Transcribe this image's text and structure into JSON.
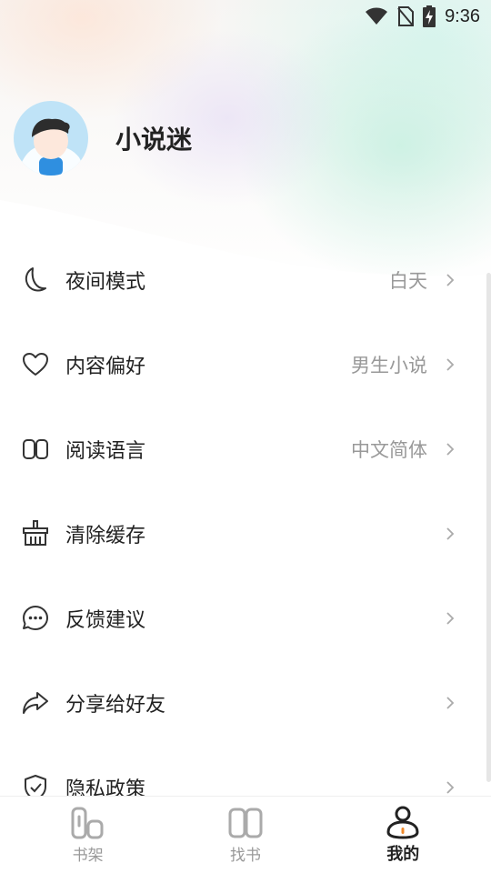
{
  "status_bar": {
    "time": "9:36",
    "icons": [
      "wifi-icon",
      "no-sim-icon",
      "battery-charging-icon"
    ]
  },
  "profile": {
    "username": "小说迷"
  },
  "menu": {
    "items": [
      {
        "label": "夜间模式",
        "value": "白天",
        "icon": "moon-icon"
      },
      {
        "label": "内容偏好",
        "value": "男生小说",
        "icon": "heart-icon"
      },
      {
        "label": "阅读语言",
        "value": "中文简体",
        "icon": "book-open-icon"
      },
      {
        "label": "清除缓存",
        "value": "",
        "icon": "broom-icon"
      },
      {
        "label": "反馈建议",
        "value": "",
        "icon": "chat-bubble-icon"
      },
      {
        "label": "分享给好友",
        "value": "",
        "icon": "share-arrow-icon"
      },
      {
        "label": "隐私政策",
        "value": "",
        "icon": "shield-check-icon"
      }
    ]
  },
  "tabbar": {
    "tabs": [
      {
        "label": "书架",
        "icon": "bookshelf-icon",
        "active": false
      },
      {
        "label": "找书",
        "icon": "find-book-icon",
        "active": false
      },
      {
        "label": "我的",
        "icon": "profile-icon",
        "active": true
      }
    ]
  },
  "colors": {
    "accent": "#f0892a",
    "text_primary": "#222222",
    "text_secondary": "#999999"
  }
}
